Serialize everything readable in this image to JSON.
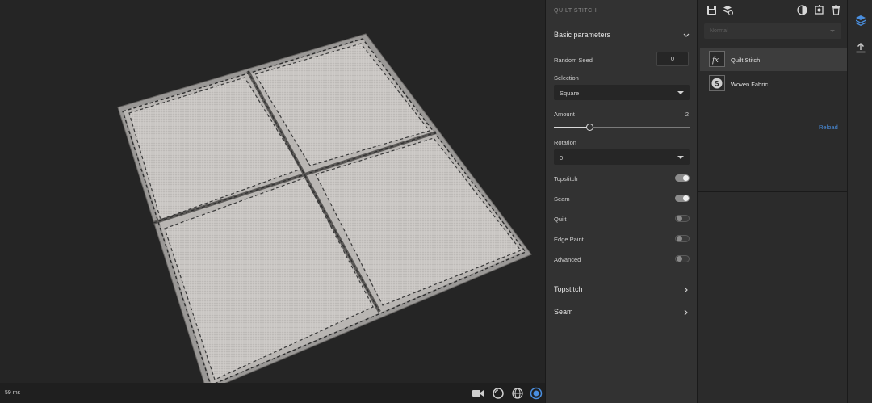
{
  "viewport": {
    "render_time": "59 ms",
    "icons": [
      "camera-icon",
      "environment-icon",
      "globe-icon",
      "display-icon"
    ]
  },
  "properties": {
    "title": "QUILT STITCH",
    "basic_section": "Basic parameters",
    "random_seed_label": "Random Seed",
    "random_seed_value": "0",
    "selection_label": "Selection",
    "selection_value": "Square",
    "amount_label": "Amount",
    "amount_value": "2",
    "amount_fraction": 0.26,
    "rotation_label": "Rotation",
    "rotation_value": "0",
    "toggles": [
      {
        "label": "Topstitch",
        "on": true
      },
      {
        "label": "Seam",
        "on": true
      },
      {
        "label": "Quilt",
        "on": false
      },
      {
        "label": "Edge Paint",
        "on": false
      },
      {
        "label": "Advanced",
        "on": false
      }
    ],
    "topstitch_section": "Topstitch",
    "seam_section": "Seam"
  },
  "layers": {
    "blend_mode": "Normal",
    "items": [
      {
        "name": "Quilt Stitch",
        "icon": "fx-icon",
        "selected": true
      },
      {
        "name": "Woven Fabric",
        "icon": "substance-icon",
        "selected": false
      }
    ],
    "reload_label": "Reload",
    "toolbar_icons": [
      "save-icon",
      "add-layer-icon",
      "mask-icon",
      "bake-icon",
      "trash-icon"
    ]
  },
  "colors": {
    "accent": "#4a8fe0",
    "panel": "#323232",
    "viewport": "#252525",
    "fabric": "#c9c6c3"
  }
}
